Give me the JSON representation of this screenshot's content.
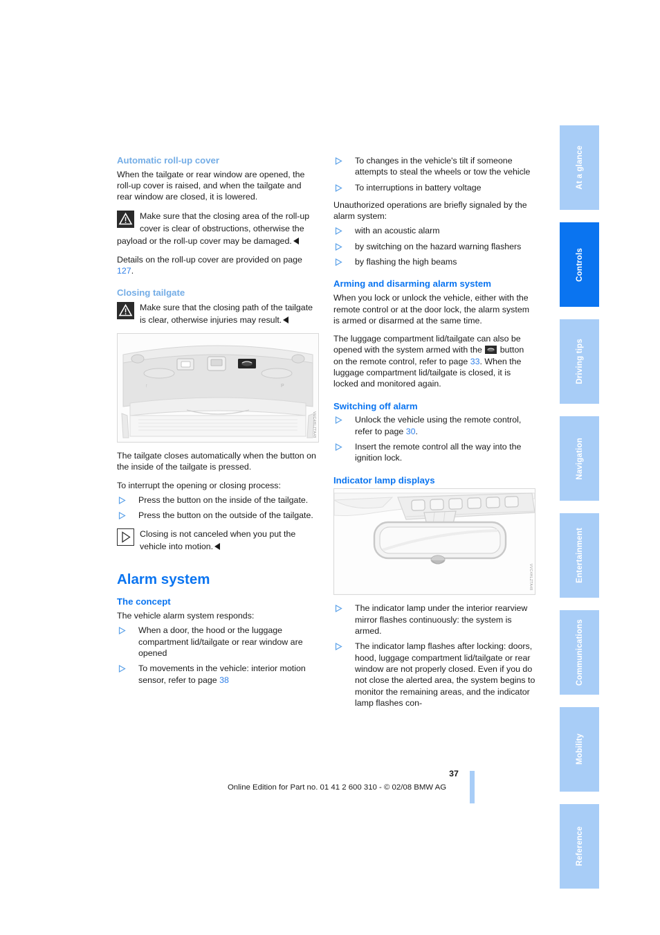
{
  "page": {
    "number": "37",
    "footer": "Online Edition for Part no. 01 41 2 600 310 - © 02/08 BMW AG"
  },
  "tabs": [
    {
      "label": "At a glance",
      "active": false
    },
    {
      "label": "Controls",
      "active": true
    },
    {
      "label": "Driving tips",
      "active": false
    },
    {
      "label": "Navigation",
      "active": false
    },
    {
      "label": "Entertainment",
      "active": false
    },
    {
      "label": "Communications",
      "active": false
    },
    {
      "label": "Mobility",
      "active": false
    },
    {
      "label": "Reference",
      "active": false
    }
  ],
  "colors": {
    "heading_strong": "#0a74f0",
    "heading_light": "#74ade6",
    "tab_inactive": "#a8cdf7",
    "tab_active": "#0a74f0",
    "link": "#2e7fe8"
  },
  "left_column": {
    "heading_rollup": "Automatic roll-up cover",
    "rollup_intro": "When the tailgate or rear window are opened, the roll-up cover is raised, and when the tailgate and rear window are closed, it is lowered.",
    "rollup_warning": "Make sure that the closing area of the roll-up cover is clear of obstructions, otherwise the payload or the roll-up cover may be damaged.",
    "rollup_details_before": "Details on the roll-up cover are provided on page ",
    "rollup_details_page": "127",
    "rollup_details_after": ".",
    "heading_closing": "Closing tailgate",
    "closing_warning": "Make sure that the closing path of the tailgate is clear, otherwise injuries may result.",
    "figure_tailgate_code": "VVC4HLZTA48",
    "tailgate_auto": "The tailgate closes automatically when the button on the inside of the tailgate is pressed.",
    "interrupt_lead": "To interrupt the opening or closing process:",
    "interrupt_items": [
      "Press the button on the inside of the tailgate.",
      "Press the button on the outside of the tailgate."
    ],
    "closing_note": "Closing is not canceled when you put the vehicle into motion.",
    "heading_alarm": "Alarm system",
    "heading_concept": "The concept",
    "concept_lead": "The vehicle alarm system responds:",
    "concept_items": [
      {
        "text": "When a door, the hood or the luggage compartment lid/tailgate or rear window are opened",
        "page": ""
      },
      {
        "text": "To movements in the vehicle: interior motion sensor, refer to page ",
        "page": "38"
      }
    ]
  },
  "right_column": {
    "responds_items": [
      "To changes in the vehicle's tilt if someone attempts to steal the wheels or tow the vehicle",
      "To interruptions in battery voltage"
    ],
    "signaled_lead": "Unauthorized operations are briefly signaled by the alarm system:",
    "signaled_items": [
      "with an acoustic alarm",
      "by switching on the hazard warning flashers",
      "by flashing the high beams"
    ],
    "heading_arming": "Arming and disarming alarm system",
    "arming_p1": "When you lock or unlock the vehicle, either with the remote control or at the door lock, the alarm system is armed or disarmed at the same time.",
    "arming_p2_a": "The luggage compartment lid/tailgate can also be opened with the system armed with the ",
    "arming_p2_b": " button on the remote control, refer to page ",
    "arming_p2_page": "33",
    "arming_p2_c": ". When the luggage compartment lid/tailgate is closed, it is locked and monitored again.",
    "heading_switching": "Switching off alarm",
    "switching_item1_a": "Unlock the vehicle using the remote control, refer to page ",
    "switching_item1_page": "30",
    "switching_item1_b": ".",
    "switching_item2": "Insert the remote control all the way into the ignition lock.",
    "heading_indicator": "Indicator lamp displays",
    "figure_mirror_code": "VVC4HLZTA48",
    "indicator_items": [
      "The indicator lamp under the interior rearview mirror flashes continuously: the system is armed.",
      "The indicator lamp flashes after locking: doors, hood, luggage compartment lid/tailgate or rear window are not properly closed. Even if you do not close the alerted area, the system begins to monitor the remaining areas, and the indicator lamp flashes con-"
    ]
  },
  "icons": {
    "warning": "warning-triangle-icon",
    "info": "info-triangle-icon",
    "bullet": "triangle-bullet-icon",
    "trunk_button": "trunk-release-button-icon"
  }
}
